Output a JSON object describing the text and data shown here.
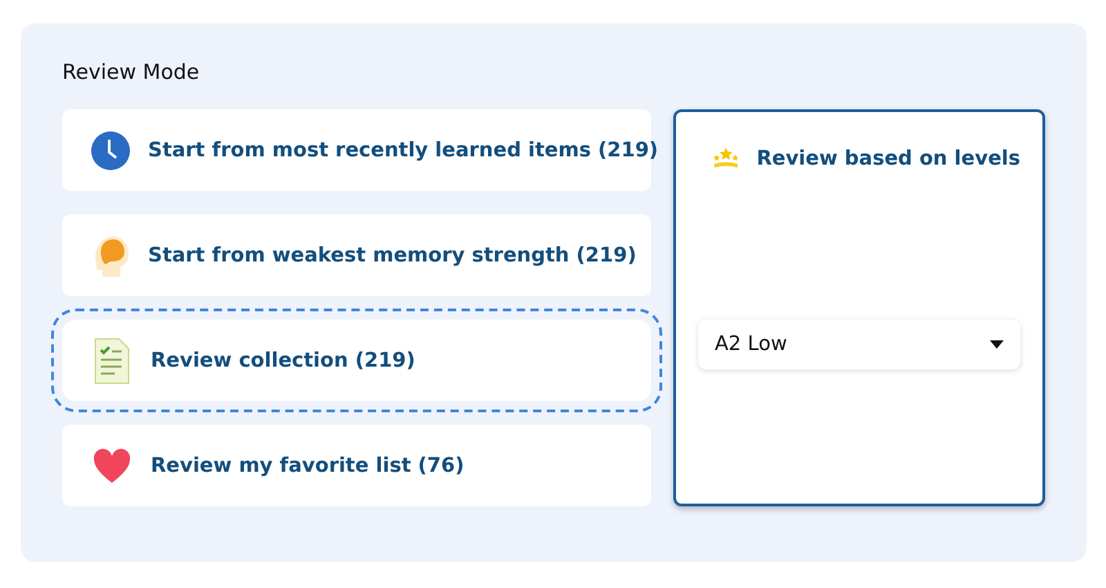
{
  "section": {
    "title": "Review Mode"
  },
  "modes": [
    {
      "kind": "clock",
      "label": "Start from most recently learned items (219)",
      "focused": false
    },
    {
      "kind": "brain",
      "label": "Start from weakest memory strength (219)",
      "focused": false
    },
    {
      "kind": "checklist",
      "label": "Review collection (219)",
      "focused": true
    },
    {
      "kind": "heart",
      "label": "Review my favorite list (76)",
      "focused": false
    }
  ],
  "levels_card": {
    "title": "Review based on levels",
    "selected": true,
    "dropdown": {
      "value": "A2 Low"
    }
  }
}
